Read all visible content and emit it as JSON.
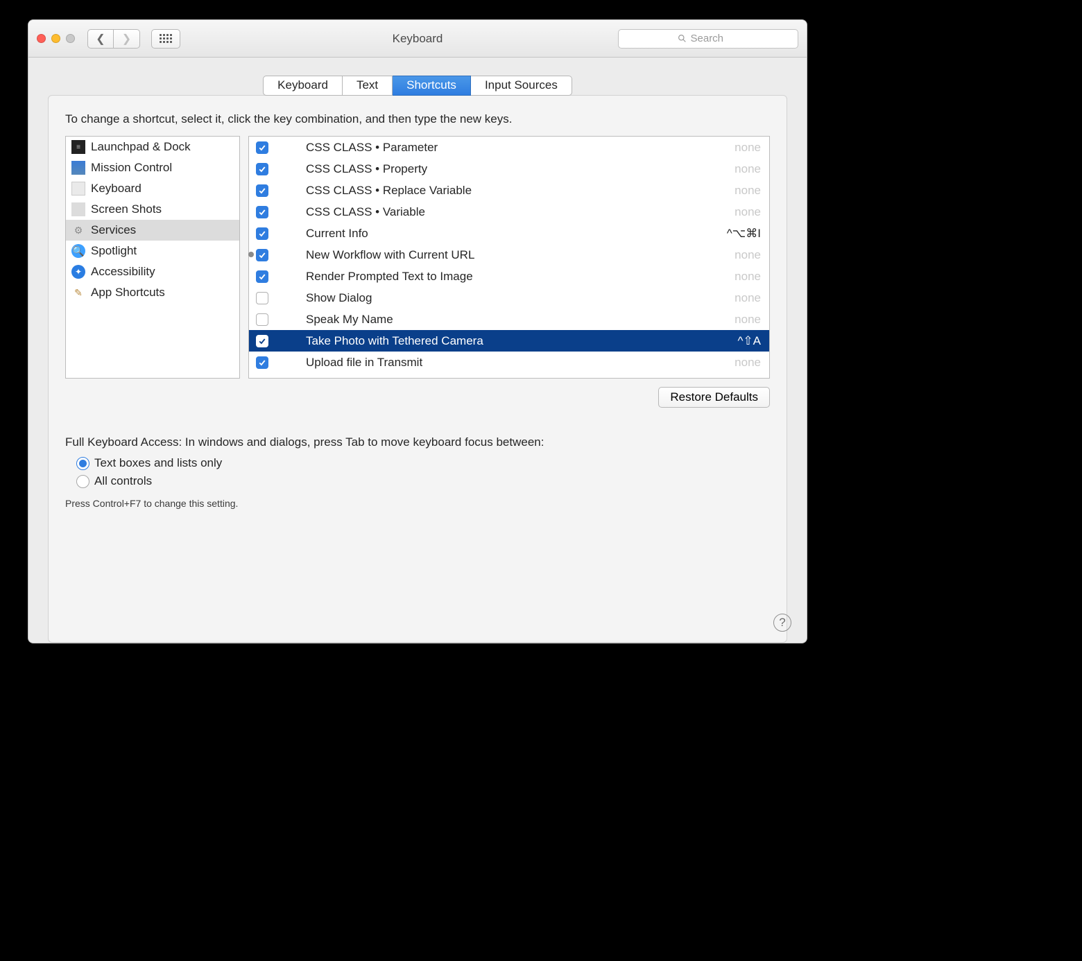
{
  "window": {
    "title": "Keyboard"
  },
  "search": {
    "placeholder": "Search"
  },
  "tabs": [
    {
      "label": "Keyboard"
    },
    {
      "label": "Text"
    },
    {
      "label": "Shortcuts"
    },
    {
      "label": "Input Sources"
    }
  ],
  "active_tab_index": 2,
  "instruction": "To change a shortcut, select it, click the key combination, and then type the new keys.",
  "sidebar": {
    "items": [
      {
        "label": "Launchpad & Dock"
      },
      {
        "label": "Mission Control"
      },
      {
        "label": "Keyboard"
      },
      {
        "label": "Screen Shots"
      },
      {
        "label": "Services"
      },
      {
        "label": "Spotlight"
      },
      {
        "label": "Accessibility"
      },
      {
        "label": "App Shortcuts"
      }
    ],
    "selected_index": 4
  },
  "shortcuts": {
    "items": [
      {
        "checked": true,
        "label": "CSS CLASS • Parameter",
        "key": "none",
        "key_none": true
      },
      {
        "checked": true,
        "label": "CSS CLASS • Property",
        "key": "none",
        "key_none": true
      },
      {
        "checked": true,
        "label": "CSS CLASS • Replace Variable",
        "key": "none",
        "key_none": true
      },
      {
        "checked": true,
        "label": "CSS CLASS • Variable",
        "key": "none",
        "key_none": true
      },
      {
        "checked": true,
        "label": "Current Info",
        "key": "^⌥⌘I",
        "key_none": false
      },
      {
        "checked": true,
        "label": "New Workflow with Current URL",
        "key": "none",
        "key_none": true
      },
      {
        "checked": true,
        "label": "Render Prompted Text to Image",
        "key": "none",
        "key_none": true
      },
      {
        "checked": false,
        "label": "Show Dialog",
        "key": "none",
        "key_none": true
      },
      {
        "checked": false,
        "label": "Speak My Name",
        "key": "none",
        "key_none": true
      },
      {
        "checked": true,
        "label": "Take Photo with Tethered Camera",
        "key": "^⇧A",
        "key_none": false
      },
      {
        "checked": true,
        "label": "Upload file in Transmit",
        "key": "none",
        "key_none": true
      }
    ],
    "selected_index": 9
  },
  "restore_label": "Restore Defaults",
  "fka_text": "Full Keyboard Access: In windows and dialogs, press Tab to move keyboard focus between:",
  "radios": [
    {
      "label": "Text boxes and lists only"
    },
    {
      "label": "All controls"
    }
  ],
  "radio_selected_index": 0,
  "hint": "Press Control+F7 to change this setting."
}
